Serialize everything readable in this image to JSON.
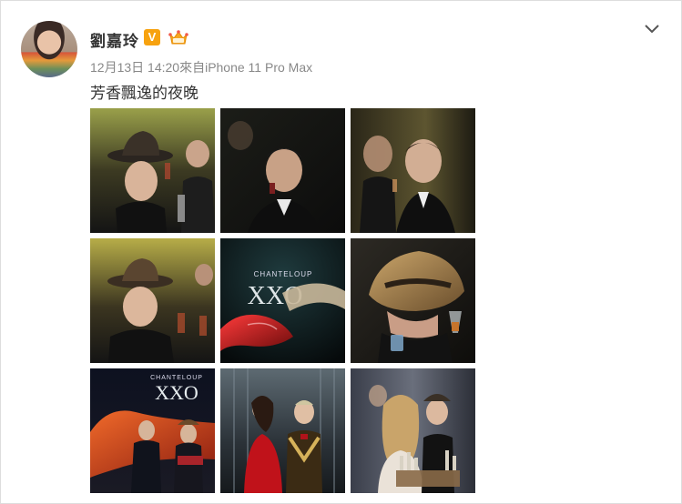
{
  "post": {
    "author": "劉嘉玲",
    "verified_badge": "V",
    "timestamp": "12月13日 14:20",
    "source": "來自iPhone 11 Pro Max",
    "text": "芳香飄逸的夜晚",
    "photos": [
      {
        "id": 1,
        "overlay_text": ""
      },
      {
        "id": 2,
        "overlay_text": ""
      },
      {
        "id": 3,
        "overlay_text": ""
      },
      {
        "id": 4,
        "overlay_text": ""
      },
      {
        "id": 5,
        "brand_small": "CHANTELOUP",
        "brand_large": "XXO"
      },
      {
        "id": 6,
        "overlay_text": ""
      },
      {
        "id": 7,
        "brand_small": "CHANTELOUP",
        "brand_large": "XXO"
      },
      {
        "id": 8,
        "overlay_text": ""
      },
      {
        "id": 9,
        "overlay_text": ""
      }
    ]
  },
  "icons": {
    "menu": "chevron-down-icon",
    "verified": "verified-v-icon",
    "member": "crown-member-icon"
  },
  "colors": {
    "accent_verified": "#f7a20f",
    "text_main": "#333333",
    "text_meta": "#888888"
  }
}
